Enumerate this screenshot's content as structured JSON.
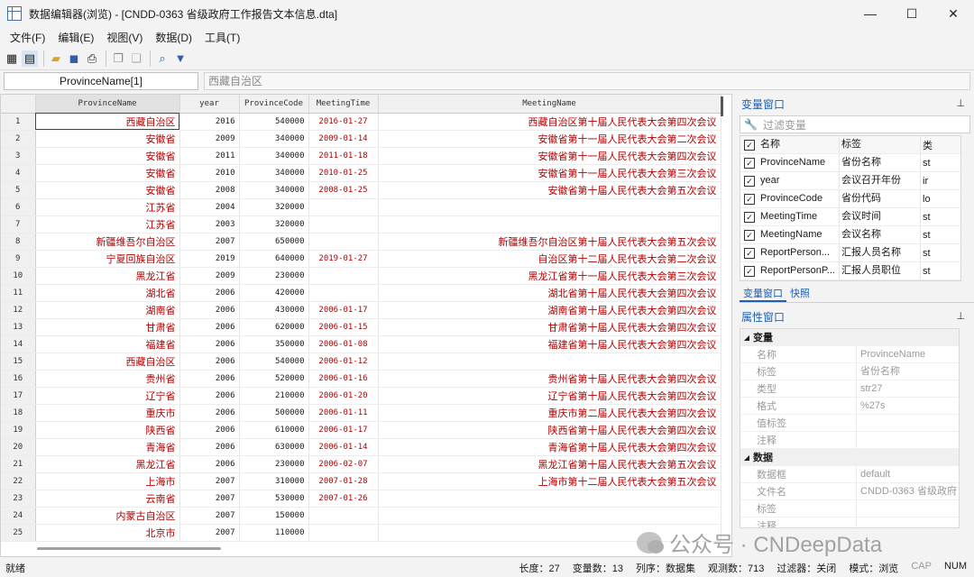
{
  "window": {
    "title": "数据编辑器(浏览) - [CNDD-0363 省级政府工作报告文本信息.dta]",
    "minimize": "—",
    "maximize": "☐",
    "close": "✕"
  },
  "menu": [
    "文件(F)",
    "编辑(E)",
    "视图(V)",
    "数据(D)",
    "工具(T)"
  ],
  "editbar": {
    "varname": "ProvinceName[1]",
    "value": "西藏自治区"
  },
  "grid": {
    "columns": [
      "ProvinceName",
      "year",
      "ProvinceCode",
      "MeetingTime",
      "MeetingName"
    ],
    "rows": [
      [
        "1",
        "西藏自治区",
        "2016",
        "540000",
        "2016-01-27",
        "西藏自治区第十届人民代表大会第四次会议"
      ],
      [
        "2",
        "安徽省",
        "2009",
        "340000",
        "2009-01-14",
        "安徽省第十一届人民代表大会第二次会议"
      ],
      [
        "3",
        "安徽省",
        "2011",
        "340000",
        "2011-01-18",
        "安徽省第十一届人民代表大会第四次会议"
      ],
      [
        "4",
        "安徽省",
        "2010",
        "340000",
        "2010-01-25",
        "安徽省第十一届人民代表大会第三次会议"
      ],
      [
        "5",
        "安徽省",
        "2008",
        "340000",
        "2008-01-25",
        "安徽省第十届人民代表大会第五次会议"
      ],
      [
        "6",
        "江苏省",
        "2004",
        "320000",
        "",
        ""
      ],
      [
        "7",
        "江苏省",
        "2003",
        "320000",
        "",
        ""
      ],
      [
        "8",
        "新疆维吾尔自治区",
        "2007",
        "650000",
        "",
        "新疆维吾尔自治区第十届人民代表大会第五次会议"
      ],
      [
        "9",
        "宁夏回族自治区",
        "2019",
        "640000",
        "2019-01-27",
        "自治区第十二届人民代表大会第二次会议"
      ],
      [
        "10",
        "黑龙江省",
        "2009",
        "230000",
        "",
        "黑龙江省第十一届人民代表大会第三次会议"
      ],
      [
        "11",
        "湖北省",
        "2006",
        "420000",
        "",
        "湖北省第十届人民代表大会第四次会议"
      ],
      [
        "12",
        "湖南省",
        "2006",
        "430000",
        "2006-01-17",
        "湖南省第十届人民代表大会第四次会议"
      ],
      [
        "13",
        "甘肃省",
        "2006",
        "620000",
        "2006-01-15",
        "甘肃省第十届人民代表大会第四次会议"
      ],
      [
        "14",
        "福建省",
        "2006",
        "350000",
        "2006-01-08",
        "福建省第十届人民代表大会第四次会议"
      ],
      [
        "15",
        "西藏自治区",
        "2006",
        "540000",
        "2006-01-12",
        ""
      ],
      [
        "16",
        "贵州省",
        "2006",
        "520000",
        "2006-01-16",
        "贵州省第十届人民代表大会第四次会议"
      ],
      [
        "17",
        "辽宁省",
        "2006",
        "210000",
        "2006-01-20",
        "辽宁省第十届人民代表大会第四次会议"
      ],
      [
        "18",
        "重庆市",
        "2006",
        "500000",
        "2006-01-11",
        "重庆市第二届人民代表大会第四次会议"
      ],
      [
        "19",
        "陕西省",
        "2006",
        "610000",
        "2006-01-17",
        "陕西省第十届人民代表大会第四次会议"
      ],
      [
        "20",
        "青海省",
        "2006",
        "630000",
        "2006-01-14",
        "青海省第十届人民代表大会第四次会议"
      ],
      [
        "21",
        "黑龙江省",
        "2006",
        "230000",
        "2006-02-07",
        "黑龙江省第十届人民代表大会第五次会议"
      ],
      [
        "22",
        "上海市",
        "2007",
        "310000",
        "2007-01-28",
        "上海市第十二届人民代表大会第五次会议"
      ],
      [
        "23",
        "云南省",
        "2007",
        "530000",
        "2007-01-26",
        ""
      ],
      [
        "24",
        "内蒙古自治区",
        "2007",
        "150000",
        "",
        ""
      ],
      [
        "25",
        "北京市",
        "2007",
        "110000",
        "",
        ""
      ]
    ]
  },
  "varpane": {
    "title": "变量窗口",
    "filter_placeholder": "过滤变量",
    "headers": [
      "名称",
      "标签",
      "类"
    ],
    "vars": [
      [
        "ProvinceName",
        "省份名称",
        "st"
      ],
      [
        "year",
        "会议召开年份",
        "ir"
      ],
      [
        "ProvinceCode",
        "省份代码",
        "lo"
      ],
      [
        "MeetingTime",
        "会议时间",
        "st"
      ],
      [
        "MeetingName",
        "会议名称",
        "st"
      ],
      [
        "ReportPerson...",
        "汇报人员名称",
        "st"
      ],
      [
        "ReportPersonP...",
        "汇报人员职位",
        "st"
      ]
    ],
    "tabs": [
      "变量窗口",
      "快照"
    ]
  },
  "proppane": {
    "title": "属性窗口",
    "sections": [
      {
        "name": "变量",
        "rows": [
          [
            "名称",
            "ProvinceName"
          ],
          [
            "标签",
            "省份名称"
          ],
          [
            "类型",
            "str27"
          ],
          [
            "格式",
            "%27s"
          ],
          [
            "值标签",
            ""
          ],
          [
            "注释",
            ""
          ]
        ]
      },
      {
        "name": "数据",
        "rows": [
          [
            "数据框",
            "default"
          ],
          [
            "文件名",
            "CNDD-0363 省级政府"
          ],
          [
            "标签",
            ""
          ],
          [
            "注释",
            ""
          ]
        ]
      }
    ]
  },
  "status": {
    "left": "就绪",
    "length": "长度：27",
    "vars": "变量数：13",
    "order": "列序：数据集",
    "obs": "观测数：713",
    "filter": "过滤器：关闭",
    "mode": "模式：浏览",
    "cap": "CAP",
    "num": "NUM"
  },
  "watermark": "公众号 · CNDeepData"
}
